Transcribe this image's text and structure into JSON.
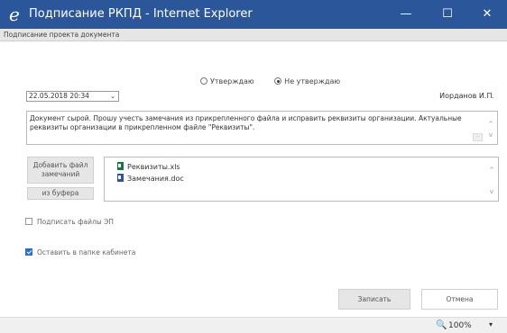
{
  "window": {
    "title": "Подписание РКПД - Internet Explorer",
    "minimize": "—",
    "maximize": "☐",
    "close": "✕"
  },
  "subheader": "Подписание проекта документа",
  "approval": {
    "options": [
      "Утверждаю",
      "Не утверждаю"
    ],
    "selected": "Не утверждаю"
  },
  "date_select": {
    "value": "22.05.2018 20:34",
    "chevron": "⌄"
  },
  "author": "Иорданов И.П.",
  "comment": "Документ сырой. Прошу учесть замечания из прикрепленного файла и исправить реквизиты организации. Актуальные реквизиты организации в прикрепленном файле \"Реквизиты\".",
  "buttons": {
    "add_file": "Добавить файл замечаний",
    "from_buffer": "из буфера",
    "save": "Записать",
    "cancel": "Отмена"
  },
  "files": [
    {
      "name": "Реквизиты.xls",
      "type": "xls"
    },
    {
      "name": "Замечания.doc",
      "type": "doc"
    }
  ],
  "checkboxes": [
    {
      "label": "Подписать файлы ЭП",
      "checked": false
    },
    {
      "label": "Оставить в папке кабинета",
      "checked": true
    }
  ],
  "status": {
    "zoom": "100%",
    "dropdown": "▾"
  },
  "colors": {
    "titlebar": "#2b579a",
    "checkbox_accent": "#2b6fc4"
  }
}
